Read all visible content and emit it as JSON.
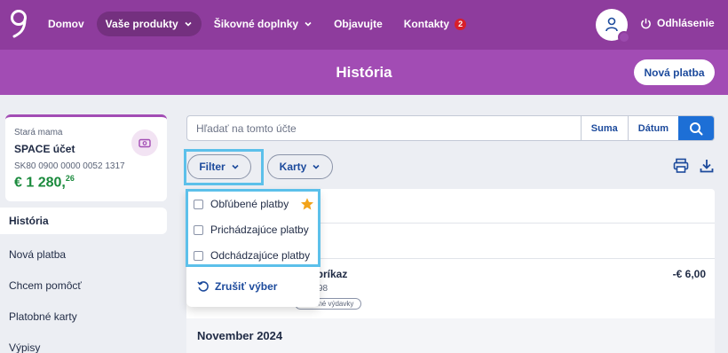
{
  "colors": {
    "brand_dark": "#8e3c9d",
    "brand": "#a24cb4",
    "link": "#1c4a9c",
    "positive": "#1a8a3c",
    "highlight": "#5cc0ea",
    "star": "#f2a31a"
  },
  "nav": {
    "items": [
      {
        "label": "Domov",
        "active": false,
        "dropdown": false
      },
      {
        "label": "Vaše produkty",
        "active": true,
        "dropdown": true
      },
      {
        "label": "Šikovné doplnky",
        "active": false,
        "dropdown": true
      },
      {
        "label": "Objavujte",
        "active": false,
        "dropdown": false
      },
      {
        "label": "Kontakty",
        "active": false,
        "dropdown": false,
        "badge": "2"
      }
    ],
    "logout": "Odhlásenie"
  },
  "header": {
    "title": "História",
    "new_payment": "Nová platba"
  },
  "account": {
    "name": "Stará mama",
    "type": "SPACE účet",
    "iban": "SK80 0900 0000 0052 1317",
    "balance_main": "€ 1 280,",
    "balance_cents": "26"
  },
  "sidebar": {
    "items": [
      {
        "label": "História",
        "active": true
      },
      {
        "label": "Nová platba"
      },
      {
        "label": "Chcem pomôcť"
      },
      {
        "label": "Platobné karty"
      },
      {
        "label": "Výpisy"
      }
    ]
  },
  "search": {
    "placeholder": "Hľadať na tomto účte",
    "amount": "Suma",
    "date": "Dátum"
  },
  "filters": {
    "filter": "Filter",
    "cards": "Karty"
  },
  "dropdown": {
    "options": [
      "Obľúbené platby",
      "Prichádzajúce platby",
      "Odchádzajúce platby"
    ],
    "clear": "Zrušiť výber"
  },
  "list": {
    "transaction": {
      "title_fragment": "dný príkaz",
      "sub_fragment": "98",
      "tag_fragment": "vadené výdavky",
      "amount": "-€ 6,00"
    },
    "month": "November 2024"
  }
}
